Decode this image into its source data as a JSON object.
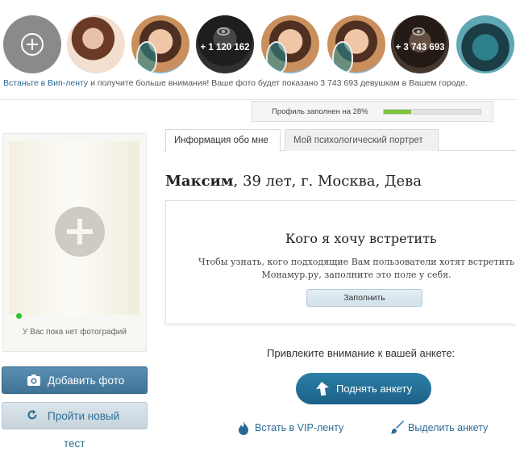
{
  "vip_strip": {
    "add_label": "",
    "avatars": [
      {
        "kind": "photo",
        "style": "woman1",
        "count": ""
      },
      {
        "kind": "photo",
        "style": "woman2",
        "count": ""
      },
      {
        "kind": "overlay",
        "style": "dark",
        "count": "+ 1 120 162"
      },
      {
        "kind": "photo",
        "style": "woman2",
        "count": ""
      },
      {
        "kind": "photo",
        "style": "woman2",
        "count": ""
      },
      {
        "kind": "overlay",
        "style": "brown",
        "count": "+ 3 743 693"
      },
      {
        "kind": "photo",
        "style": "woman3",
        "count": ""
      }
    ],
    "promo_link": "Встаньте в Вип-ленту",
    "promo_text": " и получите больше внимания! Ваше фото будет показано 3 743 693 девушкам в Вашем городе."
  },
  "profile_progress": {
    "label": "Профиль заполнен на 28%",
    "percent": 28
  },
  "photo_panel": {
    "no_photo_text": "У Вас пока нет фотографий",
    "add_photo_label": "Добавить фото",
    "test_label_line1": "Пройти новый",
    "test_label_line2": "тест"
  },
  "tabs": {
    "info": "Информация обо мне",
    "psy": "Мой психологический портрет"
  },
  "profile": {
    "name": "Максим",
    "details": ", 39 лет, г. Москва, Дева"
  },
  "meet_block": {
    "title": "Кого я хочу встретить",
    "desc_line1": "Чтобы узнать, кого подходящие Вам пользователи хотят встретить",
    "desc_line2": "Монамур.ру, заполните это поле у себя.",
    "fill_button": "Заполнить"
  },
  "promotion": {
    "attract_text": "Привлеките внимание к вашей анкете:",
    "raise_button": "Поднять анкету",
    "vip_link": "Встать в VIP-ленту",
    "highlight_link": "Выделить анкету"
  },
  "colors": {
    "accent": "#2a6b95",
    "primary_button": "#1c6187",
    "progress_fill": "#7ec53a",
    "online": "#2ec22e"
  }
}
